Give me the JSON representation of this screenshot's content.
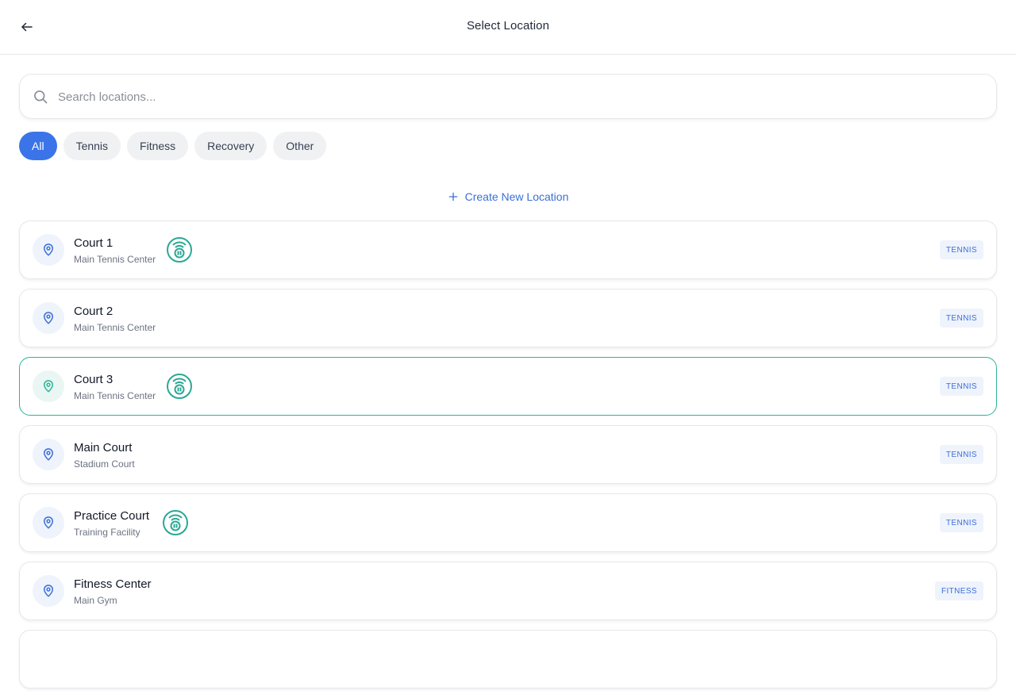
{
  "header": {
    "title": "Select Location"
  },
  "search": {
    "placeholder": "Search locations...",
    "value": ""
  },
  "filters": [
    {
      "label": "All",
      "active": true
    },
    {
      "label": "Tennis",
      "active": false
    },
    {
      "label": "Fitness",
      "active": false
    },
    {
      "label": "Recovery",
      "active": false
    },
    {
      "label": "Other",
      "active": false
    }
  ],
  "create": {
    "label": "Create New Location"
  },
  "locations": [
    {
      "name": "Court 1",
      "subtitle": "Main Tennis Center",
      "tag": "TENNIS",
      "has_sensor": true,
      "selected": false
    },
    {
      "name": "Court 2",
      "subtitle": "Main Tennis Center",
      "tag": "TENNIS",
      "has_sensor": false,
      "selected": false
    },
    {
      "name": "Court 3",
      "subtitle": "Main Tennis Center",
      "tag": "TENNIS",
      "has_sensor": true,
      "selected": true
    },
    {
      "name": "Main Court",
      "subtitle": "Stadium Court",
      "tag": "TENNIS",
      "has_sensor": false,
      "selected": false
    },
    {
      "name": "Practice Court",
      "subtitle": "Training Facility",
      "tag": "TENNIS",
      "has_sensor": true,
      "selected": false
    },
    {
      "name": "Fitness Center",
      "subtitle": "Main Gym",
      "tag": "FITNESS",
      "has_sensor": false,
      "selected": false
    }
  ],
  "icons": {
    "back": "arrow-left-icon",
    "search": "search-icon",
    "create": "plus-icon",
    "location": "map-pin-icon",
    "sensor": "sensor-icon"
  },
  "colors": {
    "accent": "#3b74e8",
    "link": "#3b6fd6",
    "selected_border": "#2bb39a",
    "sensor": "#2aa895"
  }
}
